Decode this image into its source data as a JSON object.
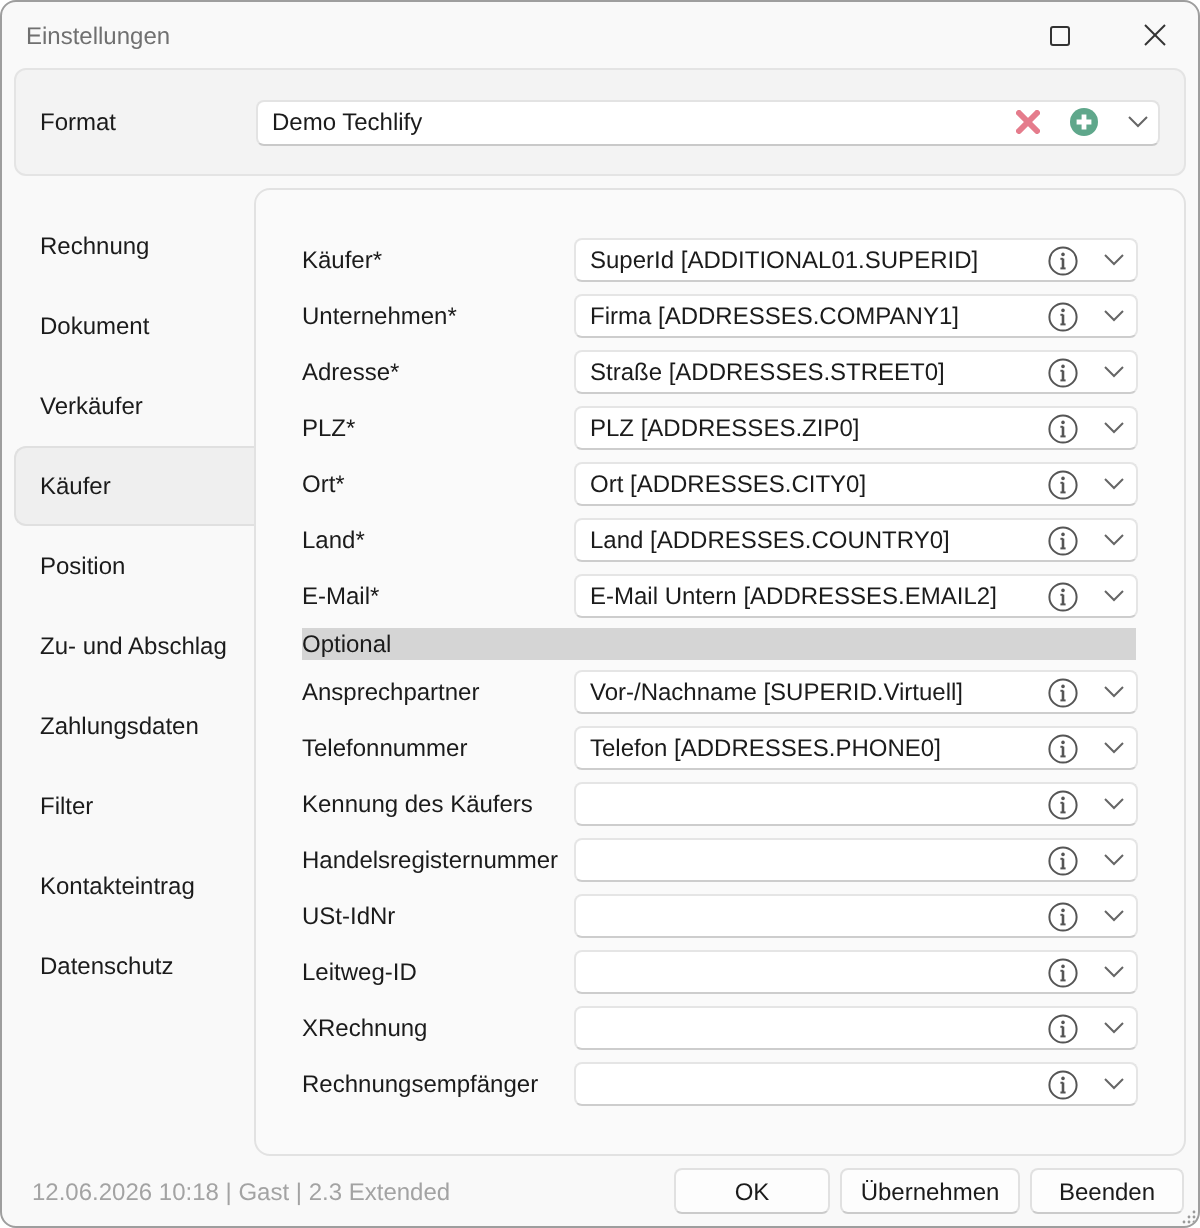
{
  "window": {
    "title": "Einstellungen"
  },
  "format": {
    "label": "Format",
    "value": "Demo Techlify"
  },
  "nav": [
    {
      "label": "Rechnung",
      "selected": false
    },
    {
      "label": "Dokument",
      "selected": false
    },
    {
      "label": "Verkäufer",
      "selected": false
    },
    {
      "label": "Käufer",
      "selected": true
    },
    {
      "label": "Position",
      "selected": false
    },
    {
      "label": "Zu- und Abschlag",
      "selected": false
    },
    {
      "label": "Zahlungsdaten",
      "selected": false
    },
    {
      "label": "Filter",
      "selected": false
    },
    {
      "label": "Kontakteintrag",
      "selected": false
    },
    {
      "label": "Datenschutz",
      "selected": false
    }
  ],
  "groups": [
    {
      "fields": [
        {
          "label": "Käufer*",
          "value": "SuperId [ADDITIONAL01.SUPERID]"
        },
        {
          "label": "Unternehmen*",
          "value": "Firma [ADDRESSES.COMPANY1]"
        },
        {
          "label": "Adresse*",
          "value": "Straße [ADDRESSES.STREET0]"
        },
        {
          "label": "PLZ*",
          "value": "PLZ [ADDRESSES.ZIP0]"
        },
        {
          "label": "Ort*",
          "value": "Ort [ADDRESSES.CITY0]"
        },
        {
          "label": "Land*",
          "value": "Land [ADDRESSES.COUNTRY0]"
        },
        {
          "label": "E-Mail*",
          "value": "E-Mail Untern [ADDRESSES.EMAIL2]"
        }
      ]
    },
    {
      "title": "Optional",
      "fields": [
        {
          "label": "Ansprechpartner",
          "value": "Vor-/Nachname [SUPERID.Virtuell]"
        },
        {
          "label": "Telefonnummer",
          "value": "Telefon [ADDRESSES.PHONE0]"
        },
        {
          "label": "Kennung des Käufers"
        },
        {
          "label": "Handelsregisternummer"
        },
        {
          "label": "USt-IdNr"
        },
        {
          "label": "Leitweg-ID"
        },
        {
          "label": "XRechnung"
        },
        {
          "label": "Rechnungsempfänger"
        }
      ]
    }
  ],
  "status_bar": "12.06.2026 10:18 | Gast | 2.3 Extended",
  "buttons": [
    "OK",
    "Übernehmen",
    "Beenden"
  ]
}
